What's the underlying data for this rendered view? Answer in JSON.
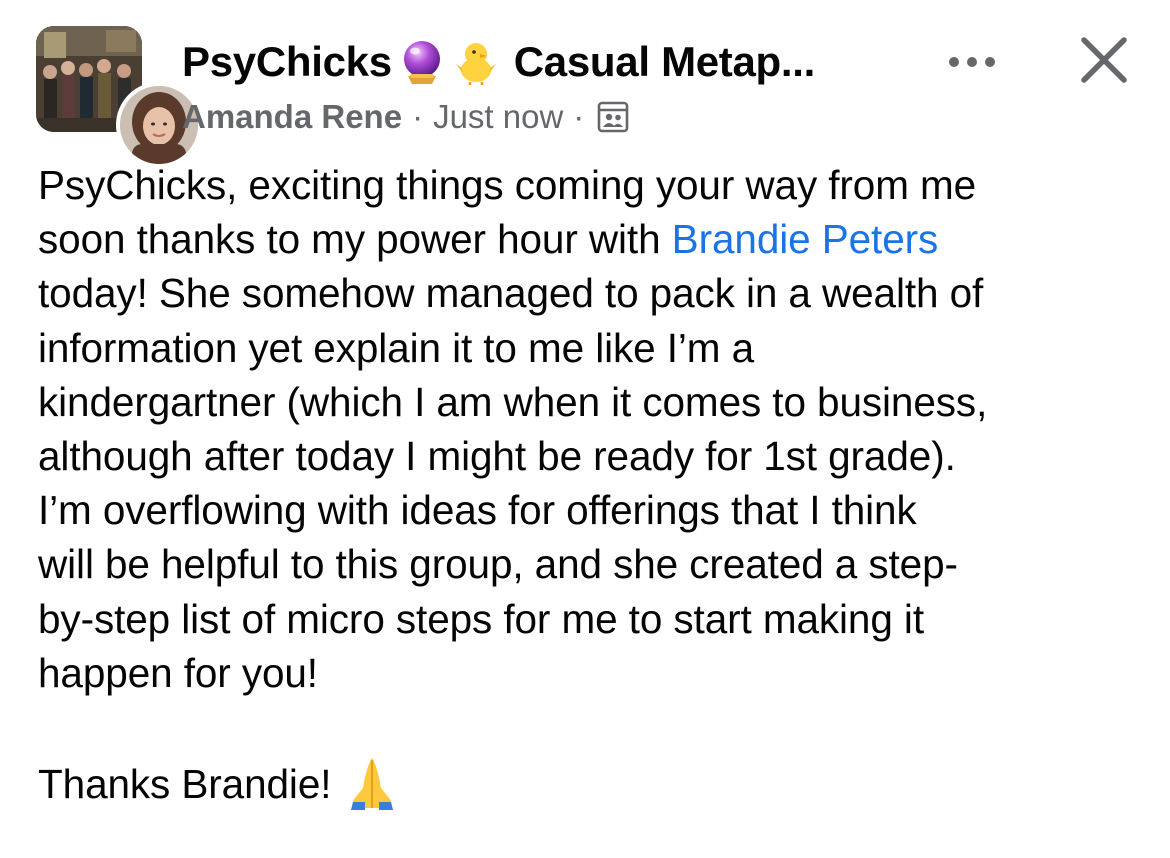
{
  "header": {
    "group_name": "PsyChicks",
    "group_emojis": [
      "crystal-ball-icon",
      "hatching-chick-icon"
    ],
    "post_title": "Casual Metap...",
    "author": "Amanda Rene",
    "separator": "·",
    "time": "Just now",
    "audience_icon": "group-members-icon",
    "more_icon": "more-horizontal-icon",
    "close_icon": "close-icon"
  },
  "body": {
    "lines": [
      "PsyChicks, exciting things coming your way from me",
      "soon thanks to my power hour with ",
      "today! She somehow managed to pack in a wealth of",
      "information yet explain it to me like I’m a",
      "kindergartner (which I am when it comes to business,",
      "although after today I might be ready for 1st grade).",
      "I’m overflowing with ideas for offerings that I think",
      "will be helpful to this group, and she created a step-",
      "by-step list of micro steps for me to start making it",
      "happen for you!"
    ],
    "mention": "Brandie Peters",
    "closing": "Thanks Brandie!",
    "closing_emoji": "folded-hands-icon"
  },
  "colors": {
    "text": "#050505",
    "secondary": "#65676b",
    "link": "#1b74e4",
    "background": "#ffffff"
  }
}
